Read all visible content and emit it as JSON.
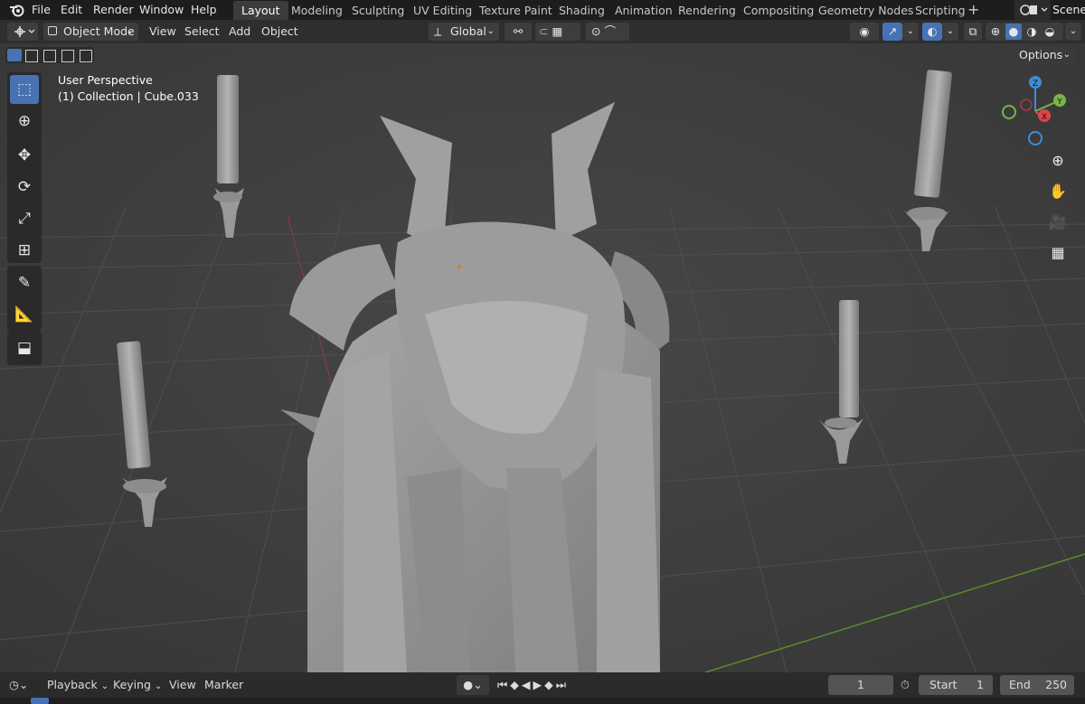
{
  "menu": {
    "file": "File",
    "edit": "Edit",
    "render": "Render",
    "window": "Window",
    "help": "Help"
  },
  "workspaces": [
    "Layout",
    "Modeling",
    "Sculpting",
    "UV Editing",
    "Texture Paint",
    "Shading",
    "Animation",
    "Rendering",
    "Compositing",
    "Geometry Nodes",
    "Scripting"
  ],
  "scene_label": "Scene",
  "header": {
    "mode": "Object Mode",
    "view": "View",
    "select": "Select",
    "add": "Add",
    "object": "Object",
    "orientation": "Global",
    "options": "Options"
  },
  "overlay": {
    "perspective": "User Perspective",
    "collection": "(1) Collection | Cube.033"
  },
  "gizmo": {
    "z": "Z",
    "y": "Y",
    "x": "X"
  },
  "timeline": {
    "playback": "Playback",
    "keying": "Keying",
    "view": "View",
    "marker": "Marker",
    "current_frame": "1",
    "start_label": "Start",
    "start_value": "1",
    "end_label": "End",
    "end_value": "250"
  },
  "colors": {
    "accent": "#4772b3",
    "x_axis": "#e0434c",
    "y_axis": "#7ab446",
    "z_axis": "#3f8cd9",
    "header": "#2e2e2e",
    "viewport": "#3d3d3d"
  }
}
